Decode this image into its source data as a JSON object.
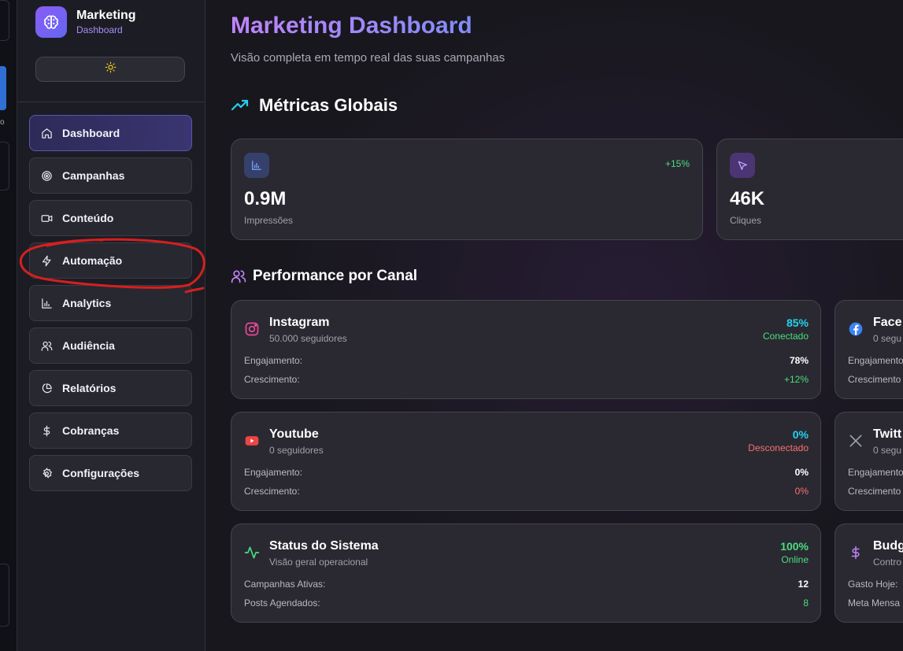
{
  "strip": {
    "fragment_text": "o"
  },
  "sidebar": {
    "brand": {
      "title": "Marketing",
      "subtitle": "Dashboard"
    },
    "theme_toggle_icon": "sun-icon",
    "items": [
      {
        "label": "Dashboard",
        "icon": "home-icon",
        "active": true
      },
      {
        "label": "Campanhas",
        "icon": "target-icon"
      },
      {
        "label": "Conteúdo",
        "icon": "video-icon"
      },
      {
        "label": "Automação",
        "icon": "zap-icon"
      },
      {
        "label": "Analytics",
        "icon": "bar-chart-icon"
      },
      {
        "label": "Audiência",
        "icon": "users-icon"
      },
      {
        "label": "Relatórios",
        "icon": "pie-chart-icon"
      },
      {
        "label": "Cobranças",
        "icon": "dollar-icon"
      },
      {
        "label": "Configurações",
        "icon": "gear-icon"
      }
    ]
  },
  "header": {
    "title": "Marketing Dashboard",
    "subtitle": "Visão completa em tempo real das suas campanhas"
  },
  "metrics": {
    "title": "Métricas Globais",
    "cards": [
      {
        "value": "0.9M",
        "label": "Impressões",
        "change": "+15%",
        "icon": "bar-chart-icon"
      },
      {
        "value": "46K",
        "label": "Cliques",
        "icon": "cursor-icon"
      }
    ]
  },
  "channels": {
    "title": "Performance por Canal",
    "cards": [
      {
        "name": "Instagram",
        "sub": "50.000 seguidores",
        "pct": "85%",
        "status": "Conectado",
        "row1_label": "Engajamento:",
        "row1_value": "78%",
        "row2_label": "Crescimento:",
        "row2_value": "+12%",
        "icon": "instagram-icon"
      },
      {
        "name": "Face",
        "sub": "0 segu",
        "row1_label": "Engajamento",
        "row2_label": "Crescimento",
        "icon": "facebook-icon"
      },
      {
        "name": "Youtube",
        "sub": "0 seguidores",
        "pct": "0%",
        "status": "Desconectado",
        "row1_label": "Engajamento:",
        "row1_value": "0%",
        "row2_label": "Crescimento:",
        "row2_value": "0%",
        "icon": "youtube-icon"
      },
      {
        "name": "Twitt",
        "sub": "0 segu",
        "row1_label": "Engajamento",
        "row2_label": "Crescimento",
        "icon": "x-icon"
      },
      {
        "name": "Status do Sistema",
        "sub": "Visão geral operacional",
        "pct": "100%",
        "status": "Online",
        "row1_label": "Campanhas Ativas:",
        "row1_value": "12",
        "row2_label": "Posts Agendados:",
        "row2_value": "8",
        "icon": "activity-icon"
      },
      {
        "name": "Budg",
        "sub": "Contro",
        "row1_label": "Gasto Hoje:",
        "row2_label": "Meta Mensa",
        "icon": "dollar-icon"
      }
    ]
  },
  "colors": {
    "accent_purple": "#a78bfa",
    "cyan": "#22d3ee",
    "green": "#4ade80",
    "red": "#f87171",
    "annotation_red": "#d61f1f"
  }
}
